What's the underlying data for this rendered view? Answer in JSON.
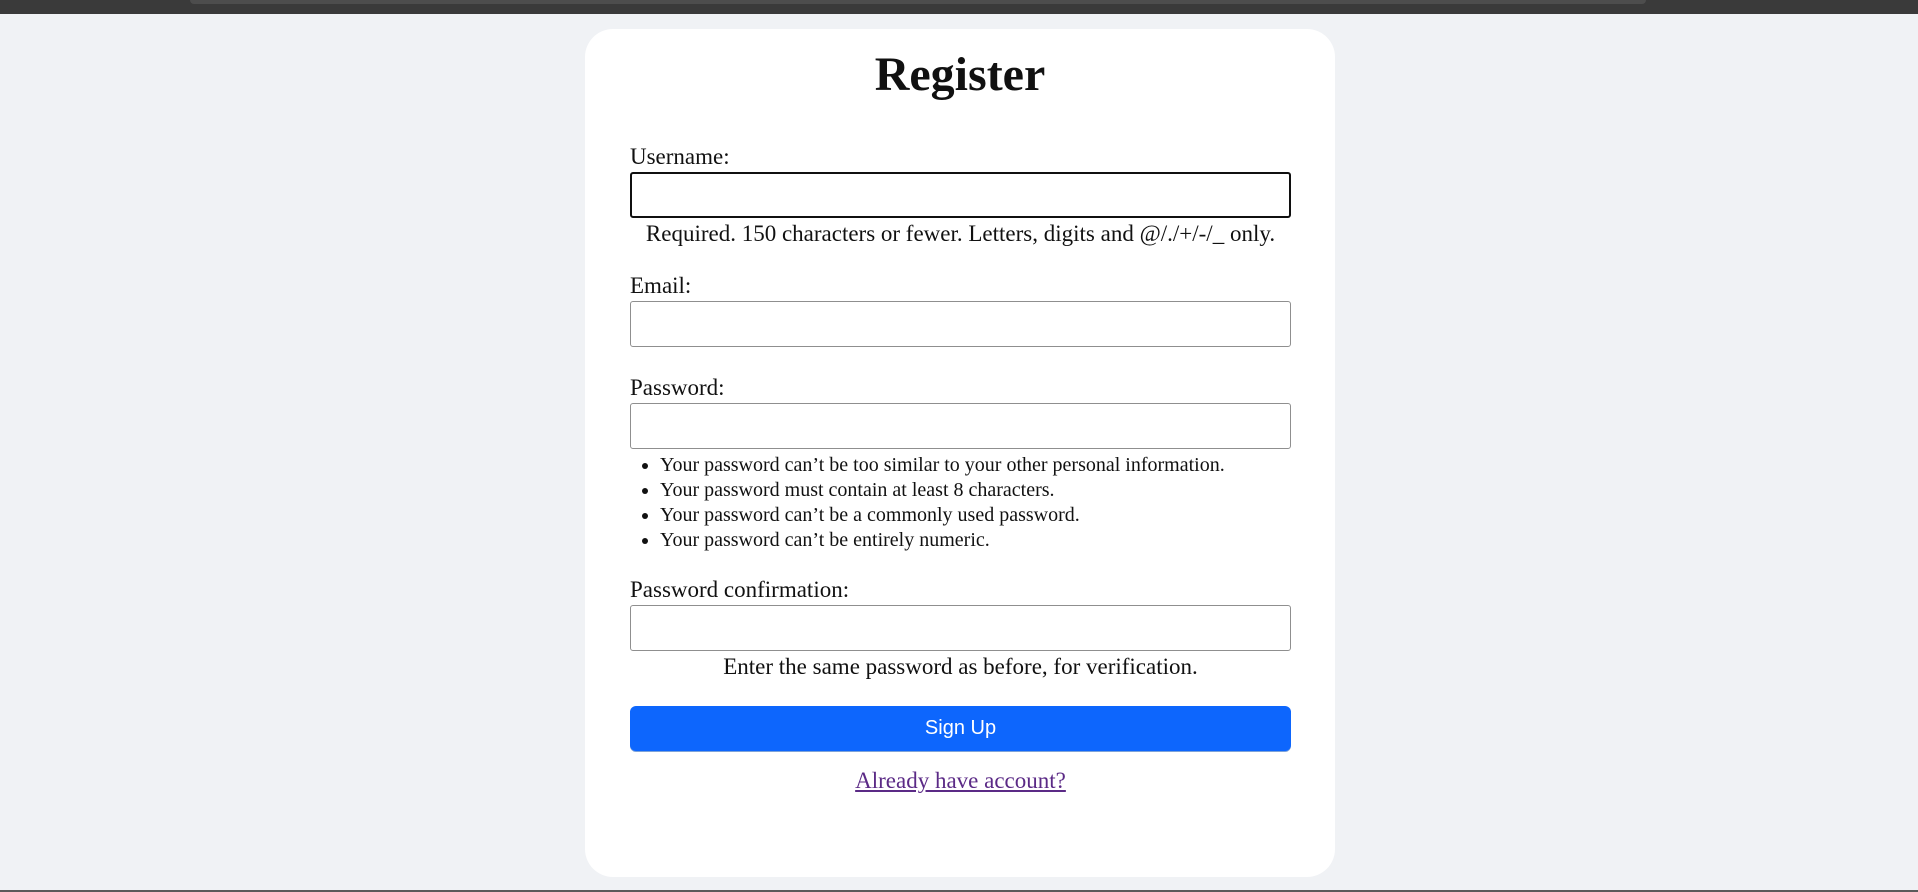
{
  "page": {
    "title": "Register"
  },
  "form": {
    "username": {
      "label": "Username:",
      "value": "",
      "help": "Required. 150 characters or fewer. Letters, digits and @/./+/-/_ only."
    },
    "email": {
      "label": "Email:",
      "value": ""
    },
    "password": {
      "label": "Password:",
      "value": "",
      "rules": [
        "Your password can’t be too similar to your other personal information.",
        "Your password must contain at least 8 characters.",
        "Your password can’t be a commonly used password.",
        "Your password can’t be entirely numeric."
      ]
    },
    "password_confirmation": {
      "label": "Password confirmation:",
      "value": "",
      "help": "Enter the same password as before, for verification."
    },
    "submit_label": "Sign Up",
    "login_link_label": "Already have account?"
  },
  "colors": {
    "background": "#f0f2f5",
    "card": "#ffffff",
    "primary_button": "#0d66fd",
    "link_visited": "#5b2a86"
  }
}
